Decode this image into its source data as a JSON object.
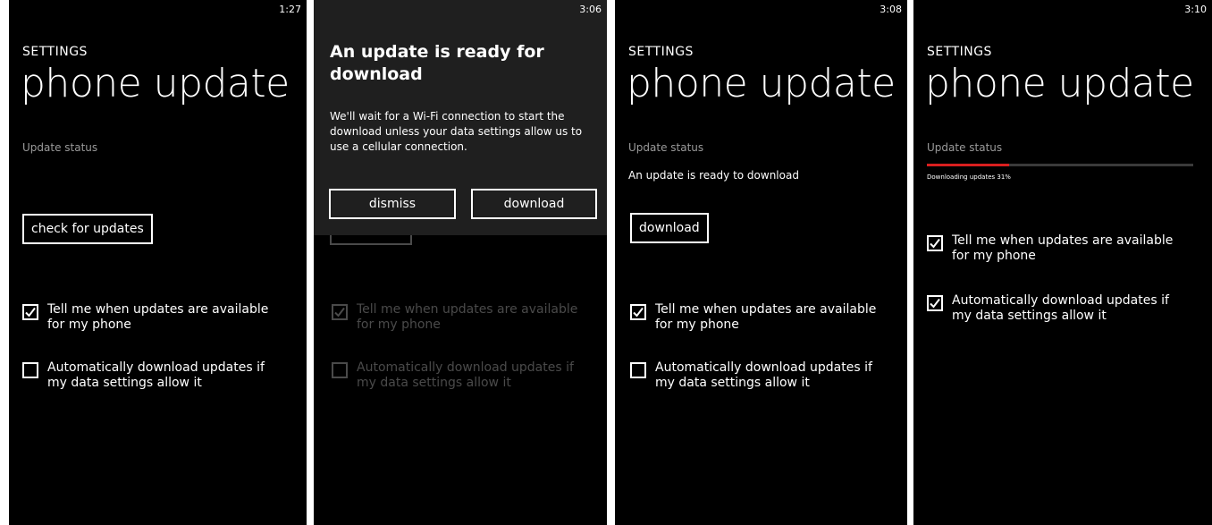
{
  "screens": [
    {
      "time": "1:27",
      "app_title": "SETTINGS",
      "page_title": "phone update",
      "status_label": "Update status",
      "button_label": "check for updates",
      "option_notify": {
        "label": "Tell me when updates are available for my phone",
        "checked": true
      },
      "option_auto": {
        "label": "Automatically download updates if my data settings allow it",
        "checked": false
      }
    },
    {
      "time": "3:06",
      "dialog": {
        "title": "An update is ready for download",
        "body": "We'll wait for a Wi-Fi connection to start the download unless your data settings allow us to use a cellular connection.",
        "dismiss_label": "dismiss",
        "download_label": "download"
      },
      "option_notify": {
        "label": "Tell me when updates are available for my phone",
        "checked": true
      },
      "option_auto": {
        "label": "Automatically download updates if my data settings allow it",
        "checked": false
      }
    },
    {
      "time": "3:08",
      "app_title": "SETTINGS",
      "page_title": "phone update",
      "status_label": "Update status",
      "status_text": "An update is ready to download",
      "button_label": "download",
      "option_notify": {
        "label": "Tell me when updates are available for my phone",
        "checked": true
      },
      "option_auto": {
        "label": "Automatically download updates if my data settings allow it",
        "checked": false
      }
    },
    {
      "time": "3:10",
      "app_title": "SETTINGS",
      "page_title": "phone update",
      "status_label": "Update status",
      "progress_text": "Downloading updates 31%",
      "progress_percent": 31,
      "option_notify": {
        "label": "Tell me when updates are available for my phone",
        "checked": true
      },
      "option_auto": {
        "label": "Automatically download updates if my data settings allow it",
        "checked": true
      }
    }
  ],
  "colors": {
    "background": "#000000",
    "text": "#ffffff",
    "accent_progress": "#d91f1f",
    "dialog_bg": "#1f1f1f",
    "muted_text": "#9a9a9a"
  }
}
